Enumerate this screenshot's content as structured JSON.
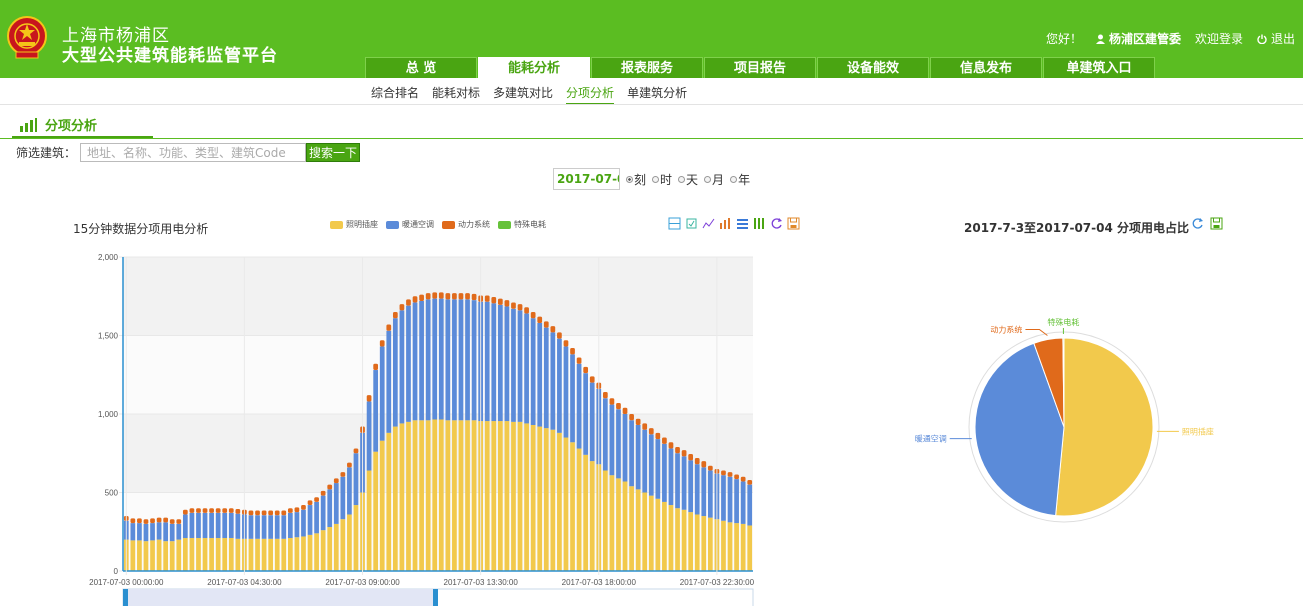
{
  "header": {
    "title_line1": "上海市杨浦区",
    "title_line2": "大型公共建筑能耗监管平台",
    "greeting": "您好！",
    "user": "杨浦区建管委",
    "welcome": "欢迎登录",
    "logout": "退出"
  },
  "nav": {
    "tabs": [
      {
        "label": "总  览"
      },
      {
        "label": "能耗分析"
      },
      {
        "label": "报表服务"
      },
      {
        "label": "项目报告"
      },
      {
        "label": "设备能效"
      },
      {
        "label": "信息发布"
      },
      {
        "label": "单建筑入口"
      }
    ],
    "active_index": 1
  },
  "subnav": {
    "items": [
      {
        "label": "综合排名"
      },
      {
        "label": "能耗对标"
      },
      {
        "label": "多建筑对比"
      },
      {
        "label": "分项分析"
      },
      {
        "label": "单建筑分析"
      }
    ],
    "active_index": 3
  },
  "section": {
    "title": "分项分析"
  },
  "filter": {
    "label": "筛选建筑：",
    "placeholder": "地址、名称、功能、类型、建筑Code",
    "button": "搜索一下"
  },
  "date": {
    "value": "2017-07-0",
    "options": [
      {
        "label": "刻",
        "checked": true
      },
      {
        "label": "时",
        "checked": false
      },
      {
        "label": "天",
        "checked": false
      },
      {
        "label": "月",
        "checked": false
      },
      {
        "label": "年",
        "checked": false
      }
    ]
  },
  "colors": {
    "brand": "#5bbd22",
    "lighting": "#f2c94c",
    "hvac": "#5b8bd9",
    "power": "#e06a1b",
    "special": "#66c23a"
  },
  "bar_chart": {
    "title": "15分钟数据分项用电分析",
    "toolbox_icons": [
      "zoom-icon",
      "zoom-reset-icon",
      "line-chart-icon",
      "bar-chart-icon",
      "stack-icon",
      "tiled-icon",
      "refresh-icon",
      "save-image-icon"
    ]
  },
  "pie_chart": {
    "title": "2017-7-3至2017-07-04 分项用电占比",
    "labels": {
      "lighting": "照明插座",
      "hvac": "暖通空调",
      "power": "动力系统",
      "special": "特殊电耗"
    }
  },
  "chart_data": [
    {
      "type": "bar",
      "stacked": true,
      "title": "15分钟数据分项用电分析",
      "ylim": [
        0,
        2000
      ],
      "yticks": [
        "0",
        "500",
        "1,000",
        "1,500",
        "2,000"
      ],
      "x_tick_labels": [
        "2017-07-03 00:00:00",
        "2017-07-03 04:30:00",
        "2017-07-03 09:00:00",
        "2017-07-03 13:30:00",
        "2017-07-03 18:00:00",
        "2017-07-03 22:30:00"
      ],
      "legend": [
        "照明插座",
        "暖通空调",
        "动力系统",
        "特殊电耗"
      ],
      "series": [
        {
          "name": "照明插座",
          "values": [
            200,
            195,
            195,
            190,
            195,
            200,
            190,
            190,
            200,
            210,
            210,
            210,
            210,
            210,
            210,
            210,
            210,
            205,
            205,
            205,
            205,
            205,
            205,
            205,
            205,
            210,
            215,
            220,
            230,
            240,
            260,
            280,
            300,
            330,
            360,
            420,
            500,
            640,
            760,
            830,
            880,
            920,
            940,
            950,
            960,
            960,
            960,
            965,
            965,
            960,
            960,
            960,
            960,
            960,
            955,
            955,
            955,
            955,
            955,
            950,
            950,
            940,
            930,
            920,
            910,
            900,
            880,
            850,
            820,
            780,
            740,
            700,
            680,
            640,
            610,
            590,
            570,
            540,
            520,
            500,
            480,
            460,
            440,
            420,
            400,
            390,
            375,
            360,
            350,
            340,
            330,
            320,
            310,
            305,
            300,
            290
          ]
        },
        {
          "name": "暖通空调",
          "values": [
            120,
            110,
            110,
            110,
            110,
            110,
            120,
            110,
            100,
            150,
            160,
            160,
            160,
            160,
            160,
            160,
            160,
            160,
            155,
            150,
            150,
            150,
            150,
            150,
            150,
            160,
            160,
            170,
            190,
            200,
            220,
            240,
            260,
            270,
            300,
            330,
            380,
            440,
            520,
            600,
            650,
            690,
            720,
            740,
            750,
            760,
            770,
            770,
            770,
            770,
            770,
            770,
            770,
            765,
            760,
            760,
            750,
            740,
            730,
            720,
            710,
            700,
            680,
            660,
            640,
            620,
            600,
            580,
            560,
            540,
            520,
            500,
            480,
            460,
            450,
            440,
            430,
            420,
            410,
            400,
            390,
            380,
            370,
            360,
            350,
            340,
            330,
            320,
            310,
            300,
            290,
            290,
            290,
            280,
            270,
            260
          ]
        },
        {
          "name": "动力系统",
          "values": [
            30,
            30,
            30,
            30,
            30,
            30,
            30,
            30,
            30,
            30,
            30,
            30,
            30,
            30,
            30,
            30,
            30,
            30,
            30,
            30,
            30,
            30,
            30,
            30,
            30,
            30,
            30,
            30,
            30,
            30,
            30,
            30,
            30,
            30,
            30,
            30,
            40,
            40,
            40,
            40,
            40,
            40,
            40,
            40,
            40,
            40,
            40,
            40,
            40,
            40,
            40,
            40,
            40,
            40,
            40,
            40,
            40,
            40,
            40,
            40,
            40,
            40,
            40,
            40,
            40,
            40,
            40,
            40,
            40,
            40,
            40,
            40,
            40,
            40,
            40,
            40,
            40,
            40,
            40,
            40,
            40,
            40,
            40,
            40,
            40,
            40,
            40,
            40,
            40,
            30,
            30,
            30,
            30,
            30,
            30,
            30
          ]
        },
        {
          "name": "特殊电耗",
          "values": [
            0,
            0,
            0,
            0,
            0,
            0,
            0,
            0,
            0,
            0,
            0,
            0,
            0,
            0,
            0,
            0,
            0,
            0,
            0,
            0,
            0,
            0,
            0,
            0,
            0,
            0,
            0,
            0,
            0,
            0,
            0,
            0,
            0,
            0,
            0,
            0,
            0,
            0,
            0,
            0,
            0,
            0,
            0,
            0,
            0,
            0,
            0,
            0,
            0,
            0,
            0,
            0,
            0,
            0,
            0,
            0,
            0,
            0,
            0,
            0,
            0,
            0,
            0,
            0,
            0,
            0,
            0,
            0,
            0,
            0,
            0,
            0,
            0,
            0,
            0,
            0,
            0,
            0,
            0,
            0,
            0,
            0,
            0,
            0,
            0,
            0,
            0,
            0,
            0,
            0,
            0,
            0,
            0,
            0,
            0,
            0
          ]
        }
      ]
    },
    {
      "type": "pie",
      "title": "2017-7-3至2017-07-04 分项用电占比",
      "slices": [
        {
          "label": "照明插座",
          "value": 51.5
        },
        {
          "label": "暖通空调",
          "value": 43
        },
        {
          "label": "动力系统",
          "value": 5.3
        },
        {
          "label": "特殊电耗",
          "value": 0.2
        }
      ]
    }
  ]
}
